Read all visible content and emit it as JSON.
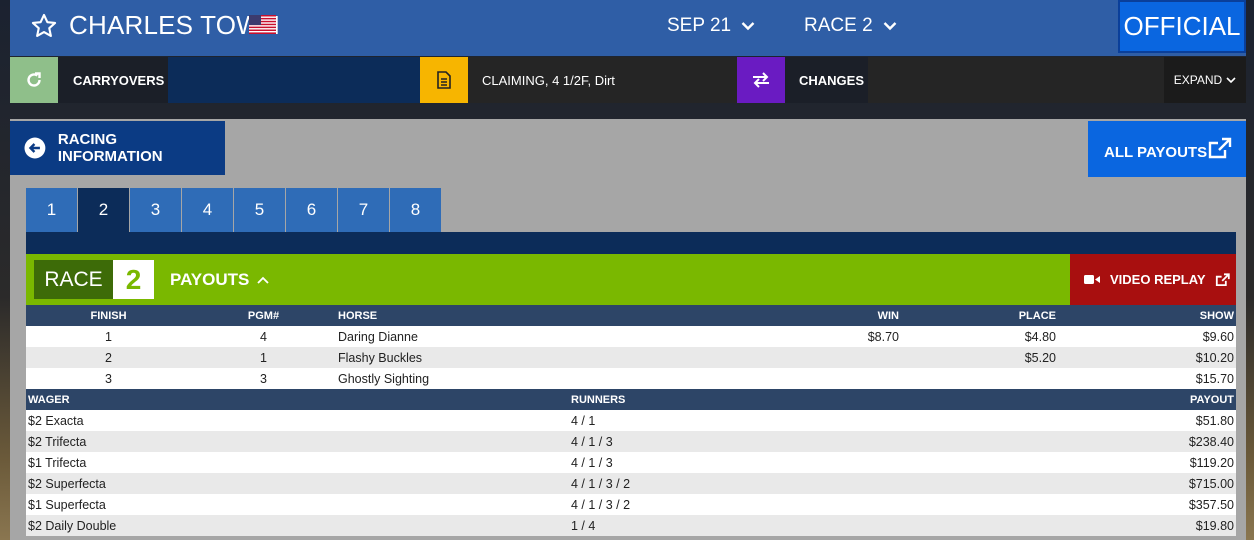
{
  "header": {
    "track_name": "CHARLES TOWN",
    "date_label": "SEP 21",
    "race_label": "RACE 2",
    "status_label": "OFFICIAL"
  },
  "infobar": {
    "carryovers_label": "CARRYOVERS",
    "race_conditions": "CLAIMING, 4 1/2F, Dirt",
    "changes_label": "CHANGES",
    "expand_label": "EXPAND"
  },
  "panel": {
    "racing_info_label": "RACING INFORMATION",
    "all_payouts_label": "ALL PAYOUTS",
    "race_tabs": [
      "1",
      "2",
      "3",
      "4",
      "5",
      "6",
      "7",
      "8"
    ],
    "active_tab": "2",
    "race_word": "RACE",
    "race_number": "2",
    "payouts_label": "PAYOUTS",
    "video_replay_label": "VIDEO REPLAY"
  },
  "finish_table": {
    "headers": [
      "FINISH",
      "PGM#",
      "HORSE",
      "WIN",
      "PLACE",
      "SHOW"
    ],
    "rows": [
      {
        "finish": "1",
        "pgm": "4",
        "horse": "Daring Dianne",
        "win": "$8.70",
        "place": "$4.80",
        "show": "$9.60"
      },
      {
        "finish": "2",
        "pgm": "1",
        "horse": "Flashy Buckles",
        "win": "",
        "place": "$5.20",
        "show": "$10.20"
      },
      {
        "finish": "3",
        "pgm": "3",
        "horse": "Ghostly Sighting",
        "win": "",
        "place": "",
        "show": "$15.70"
      }
    ]
  },
  "wager_table": {
    "headers": [
      "WAGER",
      "RUNNERS",
      "PAYOUT"
    ],
    "rows": [
      {
        "wager": "$2 Exacta",
        "runners": "4 / 1",
        "payout": "$51.80"
      },
      {
        "wager": "$2 Trifecta",
        "runners": "4 / 1 / 3",
        "payout": "$238.40"
      },
      {
        "wager": "$1 Trifecta",
        "runners": "4 / 1 / 3",
        "payout": "$119.20"
      },
      {
        "wager": "$2 Superfecta",
        "runners": "4 / 1 / 3 / 2",
        "payout": "$715.00"
      },
      {
        "wager": "$1 Superfecta",
        "runners": "4 / 1 / 3 / 2",
        "payout": "$357.50"
      },
      {
        "wager": "$2 Daily Double",
        "runners": "1 / 4",
        "payout": "$19.80"
      }
    ]
  },
  "colors": {
    "header_blue": "#2f5ea6",
    "official_blue": "#0a66e0",
    "payouts_green": "#7ab800",
    "video_red": "#a80f0f",
    "tab_active_navy": "#0c2c59"
  },
  "icons": [
    "star-icon",
    "us-flag-icon",
    "chevron-down-icon",
    "refresh-icon",
    "document-icon",
    "swap-arrows-icon",
    "back-arrow-icon",
    "external-link-icon",
    "chevron-up-icon",
    "video-camera-icon"
  ]
}
